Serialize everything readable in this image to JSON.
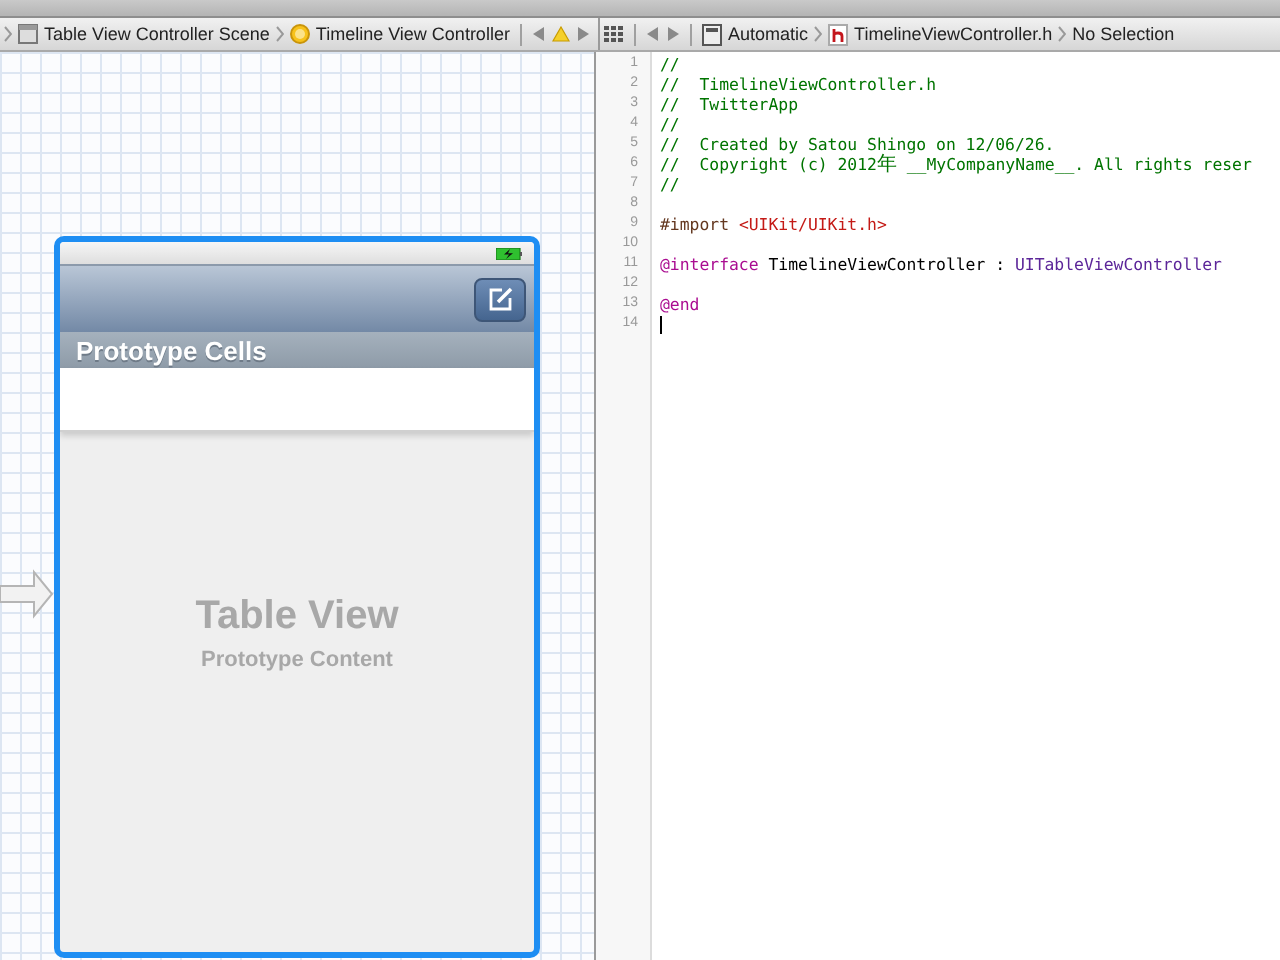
{
  "jump_bar_left": [
    {
      "label": "Table View Controller Scene",
      "kind": "scene"
    },
    {
      "label": "Timeline View Controller",
      "kind": "controller"
    }
  ],
  "jump_bar_right": [
    {
      "label": "Automatic",
      "kind": "automatic"
    },
    {
      "label": "TimelineViewController.h",
      "kind": "header"
    },
    {
      "label": "No Selection",
      "kind": "plain"
    }
  ],
  "storyboard": {
    "section_header": "Prototype Cells",
    "placeholder_title": "Table View",
    "placeholder_subtitle": "Prototype Content"
  },
  "editor": {
    "lines": [
      {
        "number": "1",
        "cursor": false,
        "tokens": [
          {
            "kind": "comment",
            "text": "//"
          }
        ]
      },
      {
        "number": "2",
        "cursor": false,
        "tokens": [
          {
            "kind": "comment",
            "text": "//  TimelineViewController.h"
          }
        ]
      },
      {
        "number": "3",
        "cursor": false,
        "tokens": [
          {
            "kind": "comment",
            "text": "//  TwitterApp"
          }
        ]
      },
      {
        "number": "4",
        "cursor": false,
        "tokens": [
          {
            "kind": "comment",
            "text": "//"
          }
        ]
      },
      {
        "number": "5",
        "cursor": false,
        "tokens": [
          {
            "kind": "comment",
            "text": "//  Created by Satou Shingo on 12/06/26."
          }
        ]
      },
      {
        "number": "6",
        "cursor": false,
        "tokens": [
          {
            "kind": "comment",
            "text": "//  Copyright (c) 2012"
          },
          {
            "kind": "comment_cjk",
            "text": "年"
          },
          {
            "kind": "comment",
            "text": " __MyCompanyName__. All rights reser"
          }
        ]
      },
      {
        "number": "7",
        "cursor": false,
        "tokens": [
          {
            "kind": "comment",
            "text": "//"
          }
        ]
      },
      {
        "number": "8",
        "cursor": false
      },
      {
        "number": "9",
        "cursor": false,
        "tokens": [
          {
            "kind": "directive",
            "text": "#import "
          },
          {
            "kind": "string",
            "text": "<UIKit/UIKit.h>"
          }
        ]
      },
      {
        "number": "10",
        "cursor": false
      },
      {
        "number": "11",
        "cursor": false,
        "tokens": [
          {
            "kind": "keyword",
            "text": "@interface"
          },
          {
            "kind": "plain",
            "text": " TimelineViewController : "
          },
          {
            "kind": "class",
            "text": "UITableViewController"
          }
        ]
      },
      {
        "number": "12",
        "cursor": false
      },
      {
        "number": "13",
        "cursor": false,
        "tokens": [
          {
            "kind": "keyword",
            "text": "@end"
          }
        ]
      },
      {
        "number": "14",
        "cursor": true
      }
    ]
  }
}
